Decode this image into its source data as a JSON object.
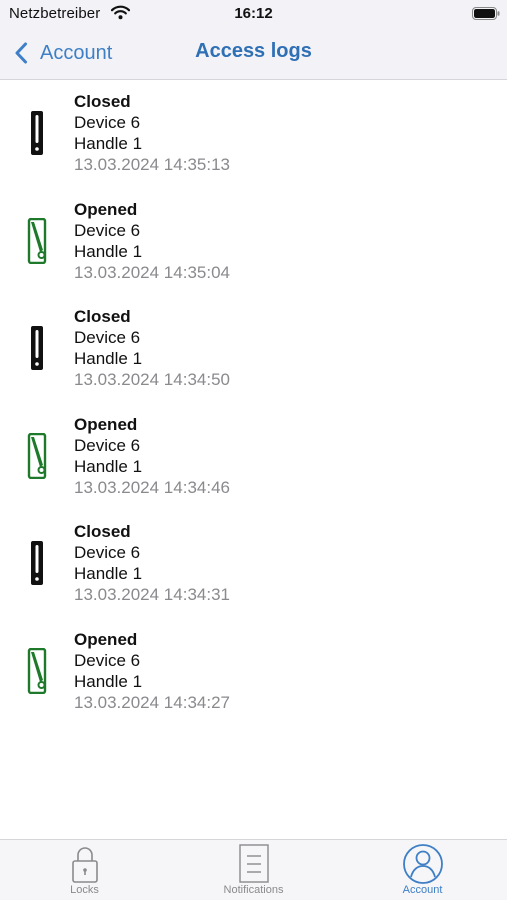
{
  "status_bar": {
    "carrier": "Netzbetreiber",
    "time": "16:12"
  },
  "nav": {
    "back_label": "Account",
    "title": "Access logs"
  },
  "logs": [
    {
      "status": "Closed",
      "device": "Device 6",
      "handle": "Handle 1",
      "timestamp": "13.03.2024 14:35:13",
      "icon": "handle-closed-icon"
    },
    {
      "status": "Opened",
      "device": "Device 6",
      "handle": "Handle 1",
      "timestamp": "13.03.2024 14:35:04",
      "icon": "handle-opened-icon"
    },
    {
      "status": "Closed",
      "device": "Device 6",
      "handle": "Handle 1",
      "timestamp": "13.03.2024 14:34:50",
      "icon": "handle-closed-icon"
    },
    {
      "status": "Opened",
      "device": "Device 6",
      "handle": "Handle 1",
      "timestamp": "13.03.2024 14:34:46",
      "icon": "handle-opened-icon"
    },
    {
      "status": "Closed",
      "device": "Device 6",
      "handle": "Handle 1",
      "timestamp": "13.03.2024 14:34:31",
      "icon": "handle-closed-icon"
    },
    {
      "status": "Opened",
      "device": "Device 6",
      "handle": "Handle 1",
      "timestamp": "13.03.2024 14:34:27",
      "icon": "handle-opened-icon"
    }
  ],
  "tabs": [
    {
      "label": "Locks",
      "icon": "lock-icon",
      "active": false
    },
    {
      "label": "Notifications",
      "icon": "document-icon",
      "active": false
    },
    {
      "label": "Account",
      "icon": "person-icon",
      "active": true
    }
  ],
  "colors": {
    "accent": "#3e7fc6",
    "opened_green": "#1e7a2a",
    "closed_black": "#111111",
    "secondary_text": "#8a8a8e"
  }
}
